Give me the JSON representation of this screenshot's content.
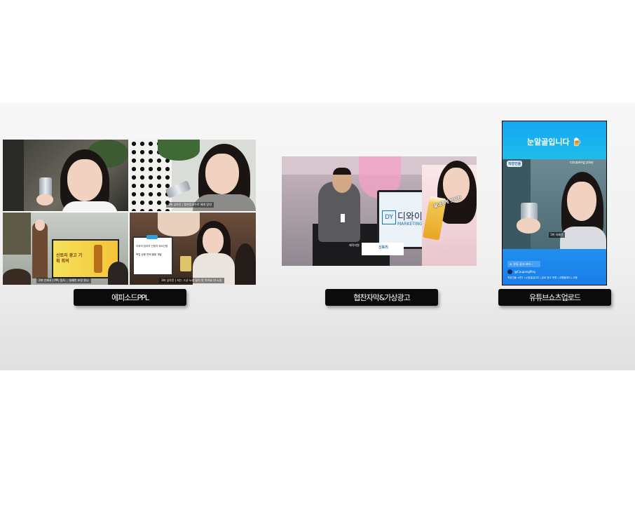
{
  "labels": {
    "episode_ppl": "에피소드PPL",
    "collab": "협찬자막&가상광고",
    "shorts": "유튜브쇼츠업로드"
  },
  "left_panel": {
    "cap_tr": "1화 심하윤 | 협찬음료수로 재개 맞대",
    "cap_bl": "2화 인제서 | PPL 팀도... 실제론 포장 왔냐",
    "screen_text": "신토리 광고 기획 회의",
    "note_title": "이외의 참여자 신청자 취소신청",
    "note_item": "목업 상품 판매 물품 개발",
    "cap_br": "3화 심하윤 | 저는 그냥 노래 많이 못 먹어요 야 노동"
  },
  "middle_panel": {
    "brand_text": "디와이",
    "brand_sub": "MARKETING",
    "logo": "DY",
    "sub_caption": "제작지원",
    "sponsor_tag": "신토리",
    "overlay_text": "끝내주게 맛지판"
  },
  "right_panel": {
    "headline": "눈알골입니다 🍺",
    "platform": "coupang play",
    "sign": "직장인들",
    "name_tag": "1화 지혜윤",
    "link_btn": "유튜 광고 보러",
    "channel": "@CoupangPlay",
    "desc": "직장인들 시즌2 | 눈알골입니다 | 유료 광고 포함 | 쿠팡플레이 | 쿠팡"
  },
  "colors": {
    "label_bg": "#0b0b0b",
    "shorts_top": "#12a6f4",
    "shorts_bottom": "#1e8ff0"
  }
}
